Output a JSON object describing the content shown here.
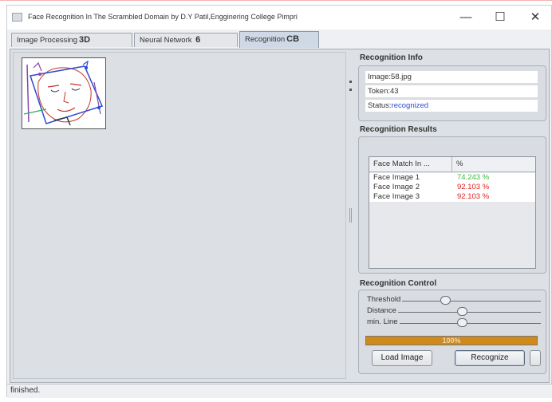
{
  "window": {
    "title": "Face Recognition In The Scrambled Domain by D.Y Patil,Engginering College Pimpri",
    "minimize": "—",
    "maximize": "☐",
    "close": "✕"
  },
  "tabs": [
    {
      "label": "Image Processing",
      "icon": "3D"
    },
    {
      "label": "Neural Network",
      "icon": "6"
    },
    {
      "label": "Recognition",
      "icon": "CB"
    }
  ],
  "recognition_info": {
    "title": "Recognition Info",
    "image_label": "Image:",
    "image_value": "58.jpg",
    "token_label": "Token:",
    "token_value": "43",
    "status_label": "Status:",
    "status_value": "recognized"
  },
  "recognition_results": {
    "title": "Recognition Results",
    "columns": [
      "Face Match In ...",
      "%"
    ],
    "rows": [
      {
        "name": "Face Image 1",
        "pct": "74.243 %",
        "color": "#3dbb3d"
      },
      {
        "name": "Face Image 2",
        "pct": "92.103 %",
        "color": "#e02020"
      },
      {
        "name": "Face Image 3",
        "pct": "92.103 %",
        "color": "#e02020"
      }
    ]
  },
  "recognition_control": {
    "title": "Recognition Control",
    "sliders": [
      {
        "label": "Threshold",
        "value": 0.45
      },
      {
        "label": "Distance",
        "value": 0.55
      },
      {
        "label": "min. Line",
        "value": 0.55
      }
    ],
    "progress": {
      "value": 1.0,
      "text": "100%"
    },
    "load_button": "Load Image",
    "recognize_button": "Recognize"
  },
  "status": {
    "text": "finished."
  },
  "colors": {
    "accent": "#d08a19",
    "status_blue": "#2a4bd1"
  }
}
